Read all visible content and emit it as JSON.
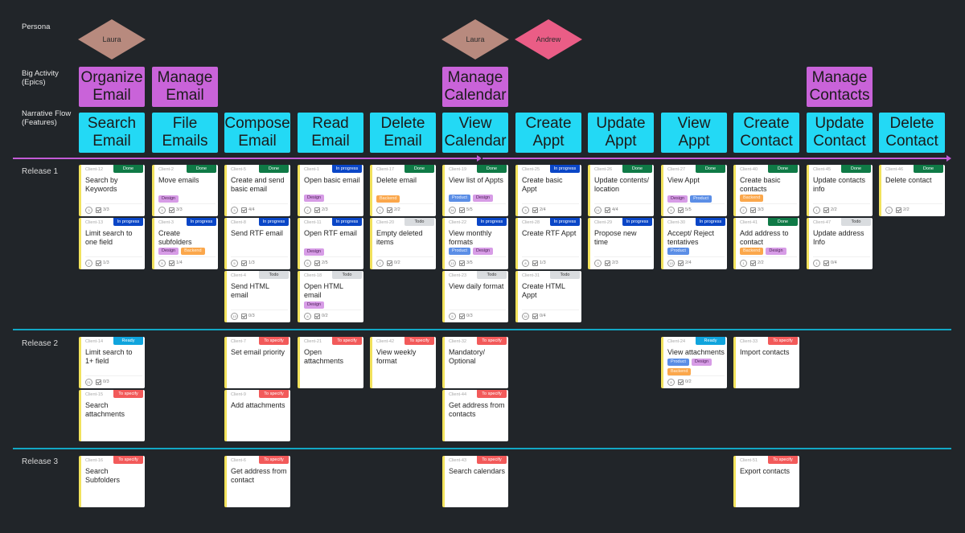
{
  "row_labels": {
    "persona": "Persona",
    "epics": [
      "Big Activity",
      "(Epics)"
    ],
    "features": [
      "Narrative Flow",
      "(Features)"
    ],
    "releases": [
      "Release 1",
      "Release 2",
      "Release 3"
    ]
  },
  "colors": {
    "background": "#212529",
    "epic": "#c963d9",
    "feature": "#23d9f5",
    "timeline": "#c35bd6",
    "separator": "#12a7c4",
    "persona_laura": "#b88a7e",
    "persona_andrew": "#ea5d86",
    "card_accent": "#f2e25c"
  },
  "personas": [
    {
      "name": "Laura",
      "column": 0,
      "color": "#b88a7e"
    },
    {
      "name": "Laura",
      "column": 5,
      "color": "#b88a7e"
    },
    {
      "name": "Andrew",
      "column": 6,
      "color": "#ea5d86"
    }
  ],
  "epics": [
    {
      "label": "Organize Email",
      "column": 0
    },
    {
      "label": "Manage Email",
      "column": 1
    },
    {
      "label": "Manage Calendar",
      "column": 5
    },
    {
      "label": "Manage Contacts",
      "column": 10
    }
  ],
  "features": [
    "Search Email",
    "File Emails",
    "Compose Email",
    "Read Email",
    "Delete Email",
    "View Calendar",
    "Create Appt",
    "Update Appt",
    "View Appt",
    "Create Contact",
    "Update Contact",
    "Delete Contact"
  ],
  "status_labels": {
    "done": "Done",
    "inprogress": "In progress",
    "todo": "Todo",
    "ready": "Ready",
    "tospecify": "To specify"
  },
  "tag_labels": {
    "design": "Design",
    "backend": "Backend",
    "product": "Product"
  },
  "cards": [
    {
      "release": 0,
      "col": 0,
      "row": 0,
      "id": "Client-12",
      "status": "done",
      "title": "Search by Keywords",
      "tags": [],
      "est": "3",
      "checks": "3/3"
    },
    {
      "release": 0,
      "col": 0,
      "row": 1,
      "id": "Client-13",
      "status": "inprogress",
      "title": "Limit search to one field",
      "tags": [],
      "est": "2",
      "checks": "1/3"
    },
    {
      "release": 0,
      "col": 1,
      "row": 0,
      "id": "Client-2",
      "status": "done",
      "title": "Move emails",
      "tags": [
        "design"
      ],
      "est": "3",
      "checks": "3/3"
    },
    {
      "release": 0,
      "col": 1,
      "row": 1,
      "id": "Client-3",
      "status": "inprogress",
      "title": "Create subfolders",
      "tags": [
        "design",
        "backend"
      ],
      "est": "5",
      "checks": "1/4"
    },
    {
      "release": 0,
      "col": 2,
      "row": 0,
      "id": "Client-5",
      "status": "done",
      "title": "Create and send basic email",
      "tags": [],
      "est": "3",
      "checks": "4/4"
    },
    {
      "release": 0,
      "col": 2,
      "row": 1,
      "id": "Client-8",
      "status": "inprogress",
      "title": "Send RTF email",
      "tags": [],
      "est": "5",
      "checks": "1/3"
    },
    {
      "release": 0,
      "col": 2,
      "row": 2,
      "id": "Client-4",
      "status": "todo",
      "title": "Send HTML email",
      "tags": [],
      "est": "13",
      "checks": "0/3"
    },
    {
      "release": 0,
      "col": 3,
      "row": 0,
      "id": "Client-1",
      "status": "inprogress",
      "title": "Open basic email",
      "tags": [
        "design"
      ],
      "est": "2",
      "checks": "2/3"
    },
    {
      "release": 0,
      "col": 3,
      "row": 1,
      "id": "Client-11",
      "status": "inprogress",
      "title": "Open RTF email",
      "tags": [
        "design"
      ],
      "est": "5",
      "checks": "2/5"
    },
    {
      "release": 0,
      "col": 3,
      "row": 2,
      "id": "Client-18",
      "status": "todo",
      "title": "Open HTML email",
      "tags": [
        "design"
      ],
      "est": "8",
      "checks": "0/2"
    },
    {
      "release": 0,
      "col": 4,
      "row": 0,
      "id": "Client-17",
      "status": "done",
      "title": "Delete email",
      "tags": [
        "backend"
      ],
      "est": "1",
      "checks": "2/2"
    },
    {
      "release": 0,
      "col": 4,
      "row": 1,
      "id": "Client-20",
      "status": "todo",
      "title": "Empty deleted items",
      "tags": [],
      "est": "2",
      "checks": "0/2"
    },
    {
      "release": 0,
      "col": 5,
      "row": 0,
      "id": "Client-19",
      "status": "done",
      "title": "View list of Appts",
      "tags": [
        "product",
        "design"
      ],
      "est": "34",
      "checks": "5/5"
    },
    {
      "release": 0,
      "col": 5,
      "row": 1,
      "id": "Client-22",
      "status": "inprogress",
      "title": "View monthly formats",
      "tags": [
        "product",
        "design"
      ],
      "est": "13",
      "checks": "3/5"
    },
    {
      "release": 0,
      "col": 5,
      "row": 2,
      "id": "Client-23",
      "status": "todo",
      "title": "View daily format",
      "tags": [],
      "est": "5",
      "checks": "0/3"
    },
    {
      "release": 0,
      "col": 6,
      "row": 0,
      "id": "Client-25",
      "status": "inprogress",
      "title": "Create basic Appt",
      "tags": [],
      "est": "3",
      "checks": "2/4"
    },
    {
      "release": 0,
      "col": 6,
      "row": 1,
      "id": "Client-28",
      "status": "inprogress",
      "title": "Create RTF Appt",
      "tags": [],
      "est": "8",
      "checks": "1/3"
    },
    {
      "release": 0,
      "col": 6,
      "row": 2,
      "id": "Client-31",
      "status": "todo",
      "title": "Create HTML Appt",
      "tags": [],
      "est": "34",
      "checks": "0/4"
    },
    {
      "release": 0,
      "col": 7,
      "row": 0,
      "id": "Client-26",
      "status": "done",
      "title": "Update contents/ location",
      "tags": [],
      "est": "21",
      "checks": "4/4"
    },
    {
      "release": 0,
      "col": 7,
      "row": 1,
      "id": "Client-29",
      "status": "inprogress",
      "title": "Propose new time",
      "tags": [],
      "est": "3",
      "checks": "2/3"
    },
    {
      "release": 0,
      "col": 8,
      "row": 0,
      "id": "Client-27",
      "status": "done",
      "title": "View Appt",
      "tags": [
        "design",
        "product"
      ],
      "est": "5",
      "checks": "5/5"
    },
    {
      "release": 0,
      "col": 8,
      "row": 1,
      "id": "Client-30",
      "status": "inprogress",
      "title": "Accept/ Reject tentatives",
      "tags": [
        "product"
      ],
      "est": "13",
      "checks": "2/4"
    },
    {
      "release": 0,
      "col": 9,
      "row": 0,
      "id": "Client-40",
      "status": "done",
      "title": "Create basic contacts",
      "tags": [
        "backend"
      ],
      "est": "2",
      "checks": "3/3"
    },
    {
      "release": 0,
      "col": 9,
      "row": 1,
      "id": "Client-41",
      "status": "done",
      "title": "Add address to contact",
      "tags": [
        "backend",
        "design"
      ],
      "est": "1",
      "checks": "2/2"
    },
    {
      "release": 0,
      "col": 10,
      "row": 0,
      "id": "Client-45",
      "status": "done",
      "title": "Update contacts info",
      "tags": [],
      "est": "1",
      "checks": "2/2"
    },
    {
      "release": 0,
      "col": 10,
      "row": 1,
      "id": "Client-47",
      "status": "todo",
      "title": "Update address Info",
      "tags": [],
      "est": "1",
      "checks": "0/4"
    },
    {
      "release": 0,
      "col": 11,
      "row": 0,
      "id": "Client-46",
      "status": "done",
      "title": "Delete contact",
      "tags": [],
      "est": "1",
      "checks": "2/2"
    },
    {
      "release": 1,
      "col": 0,
      "row": 0,
      "id": "Client-14",
      "status": "ready",
      "title": "Limit search to 1+ field",
      "tags": [],
      "est": "21",
      "checks": "0/3"
    },
    {
      "release": 1,
      "col": 0,
      "row": 1,
      "id": "Client-15",
      "status": "tospecify",
      "title": "Search attachments",
      "tags": []
    },
    {
      "release": 1,
      "col": 2,
      "row": 0,
      "id": "Client-7",
      "status": "tospecify",
      "title": "Set email priority",
      "tags": []
    },
    {
      "release": 1,
      "col": 2,
      "row": 1,
      "id": "Client-9",
      "status": "tospecify",
      "title": "Add attachments",
      "tags": []
    },
    {
      "release": 1,
      "col": 3,
      "row": 0,
      "id": "Client-21",
      "status": "tospecify",
      "title": "Open attachments",
      "tags": []
    },
    {
      "release": 1,
      "col": 4,
      "row": 0,
      "id": "Client-42",
      "status": "tospecify",
      "title": "View weekly format",
      "tags": []
    },
    {
      "release": 1,
      "col": 5,
      "row": 0,
      "id": "Client-32",
      "status": "tospecify",
      "title": "Mandatory/ Optional",
      "tags": []
    },
    {
      "release": 1,
      "col": 5,
      "row": 1,
      "id": "Client-44",
      "status": "tospecify",
      "title": "Get address from contacts",
      "tags": []
    },
    {
      "release": 1,
      "col": 8,
      "row": 0,
      "id": "Client-24",
      "status": "ready",
      "title": "View attachments",
      "tags": [
        "product",
        "design",
        "backend"
      ],
      "est": "8",
      "checks": "0/2"
    },
    {
      "release": 1,
      "col": 9,
      "row": 0,
      "id": "Client-33",
      "status": "tospecify",
      "title": "Import contacts",
      "tags": []
    },
    {
      "release": 2,
      "col": 0,
      "row": 0,
      "id": "Client-16",
      "status": "tospecify",
      "title": "Search Subfolders",
      "tags": []
    },
    {
      "release": 2,
      "col": 2,
      "row": 0,
      "id": "Client-6",
      "status": "tospecify",
      "title": "Get address from contact",
      "tags": []
    },
    {
      "release": 2,
      "col": 5,
      "row": 0,
      "id": "Client-43",
      "status": "tospecify",
      "title": "Search calendars",
      "tags": []
    },
    {
      "release": 2,
      "col": 9,
      "row": 0,
      "id": "Client-51",
      "status": "tospecify",
      "title": "Export contacts",
      "tags": []
    }
  ]
}
